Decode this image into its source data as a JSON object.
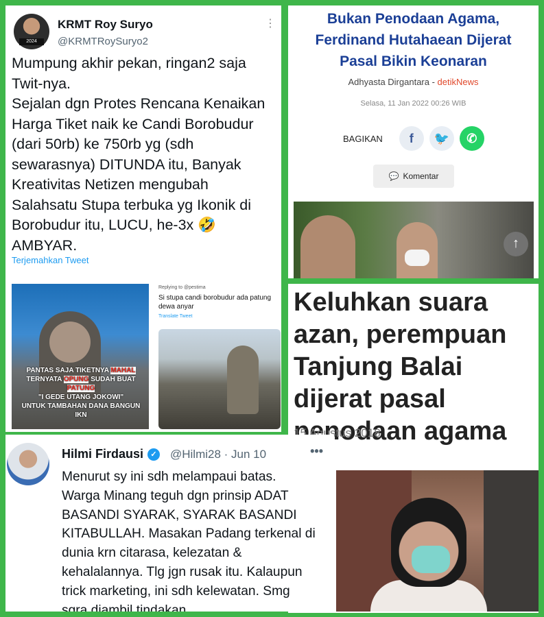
{
  "tweet1": {
    "name": "KRMT Roy Suryo",
    "handle": "@KRMTRoySuryo2",
    "avatar_badge": "2024",
    "menu": "⋮",
    "lines": [
      "Mumpung akhir pekan, ringan2 saja",
      "Twit-nya.",
      "Sejalan dgn Protes Rencana Kenaikan",
      "Harga Tiket naik ke Candi Borobudur",
      "(dari 50rb) ke 750rb yg (sdh",
      "sewarasnya) DITUNDA itu, Banyak",
      "Kreativitas Netizen mengubah",
      "Salahsatu Stupa terbuka yg Ikonik di",
      "Borobudur itu, LUCU, he-3x 🤣",
      "AMBYAR."
    ],
    "translate": "Terjemahkan Tweet",
    "media_left_caption_1": "PANTAS SAJA TIKETNYA",
    "media_left_caption_red1": "MAHAL",
    "media_left_caption_2": "TERNYATA",
    "media_left_caption_red2": "OPUNG",
    "media_left_caption_3": "SUDAH BUAT",
    "media_left_caption_red3": "PATUNG",
    "media_left_caption_4": "\"I GEDE UTANG JOKOWI\"",
    "media_left_caption_5": "UNTUK TAMBAHAN DANA BANGUN IKN",
    "media_right_reply": "Replying to @pestima",
    "media_right_text": "Si stupa candi borobudur ada patung dewa anyar",
    "media_right_translate": "Translate Tweet"
  },
  "article1": {
    "title": "Bukan Penodaan Agama, Ferdinand Hutahaean Dijerat Pasal Bikin Keonaran",
    "author": "Adhyasta Dirgantara",
    "separator": " - ",
    "source": "detikNews",
    "date": "Selasa, 11 Jan 2022 00:26 WIB",
    "share_label": "BAGIKAN",
    "fb_icon": "f",
    "tw_icon": "🐦",
    "wa_icon": "✆",
    "comment_label": "Komentar",
    "comment_icon": "💬",
    "scroll_up": "↑"
  },
  "article2": {
    "title": "Keluhkan suara azan, perempuan Tanjung Balai dijerat pasal penodaan agama",
    "date": "15 Agustus 2018"
  },
  "tweet2": {
    "name": "Hilmi Firdausi",
    "verified_icon": "✓",
    "handle": "@Hilmi28",
    "separator": " · ",
    "date": "Jun 10",
    "menu": "•••",
    "lines": [
      "Menurut sy ini sdh melampaui batas.",
      "Warga Minang teguh dgn prinsip ADAT",
      "BASANDI SYARAK, SYARAK BASANDI",
      "KITABULLAH. Masakan Padang terkenal di",
      "dunia krn citarasa, kelezatan &",
      "kehalalannya. Tlg jgn rusak itu. Kalaupun",
      "trick marketing, ini sdh kelewatan. Smg",
      "sgra diambil tindakan."
    ]
  },
  "colors": {
    "frame_green": "#3fb64a",
    "detik_title": "#1b3f96",
    "detik_source": "#e0482b",
    "twitter_blue": "#1d9bf0"
  }
}
